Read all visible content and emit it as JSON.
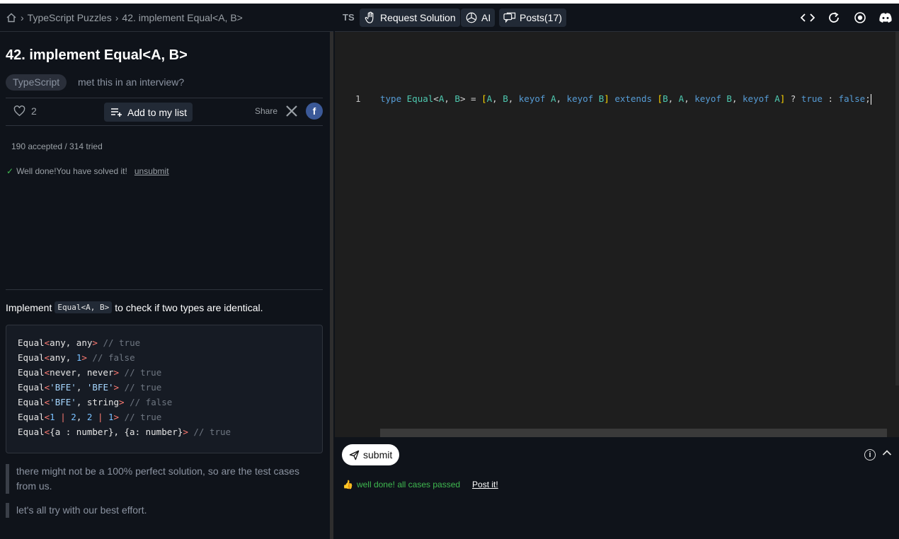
{
  "breadcrumb": {
    "category": "TypeScript Puzzles",
    "problem": "42. implement Equal<A, B>"
  },
  "problem": {
    "title": "42. implement Equal<A, B>",
    "tag": "TypeScript",
    "interview_text": "met this in an interview?",
    "likes": "2",
    "add_to_list_label": "Add to my list",
    "share_label": "Share",
    "stats": "190 accepted / 314 tried",
    "solved_text": "Well done!You have solved it!",
    "unsubmit_label": "unsubmit",
    "description_prefix": "Implement",
    "description_code": "Equal<A, B>",
    "description_suffix": "to check if two types are identical.",
    "example_code": [
      "Equal<any, any> // true",
      "Equal<any, 1> // false",
      "Equal<never, never> // true",
      "Equal<'BFE', 'BFE'> // true",
      "Equal<'BFE', string> // false",
      "Equal<1 | 2, 2 | 1> // true",
      "Equal<{a : number}, {a: number}> // true"
    ],
    "note1": "there might not be a 100% perfect solution, so are the test cases from us.",
    "note2": "let's all try with our best effort."
  },
  "toolbar": {
    "lang": "TS",
    "request_solution_label": "Request Solution",
    "ai_label": "AI",
    "posts_label": "Posts(17)"
  },
  "editor": {
    "line_number": "1",
    "code": "type Equal<A, B> = [A, B, keyof A, keyof B] extends [B, A, keyof B, keyof A] ? true : false;"
  },
  "bottom": {
    "submit_label": "submit",
    "result_text": "well done! all cases passed",
    "post_it_label": "Post it!"
  },
  "icons": {
    "home": "home-icon",
    "heart": "heart-icon",
    "list_add": "playlist-add-icon",
    "x": "x-logo-icon",
    "facebook": "facebook-icon",
    "hand": "hand-icon",
    "openai": "openai-icon",
    "posts": "chat-bubbles-icon",
    "code": "code-icon",
    "refresh": "refresh-icon",
    "record": "record-icon",
    "discord": "discord-icon",
    "send": "send-icon",
    "info": "info-icon",
    "chevron_up": "chevron-up-icon",
    "thumbs_up": "thumbs-up-icon"
  },
  "colors": {
    "success": "#3fb950",
    "facebook": "#3b5998",
    "editor_bg": "#1e1e1e"
  }
}
